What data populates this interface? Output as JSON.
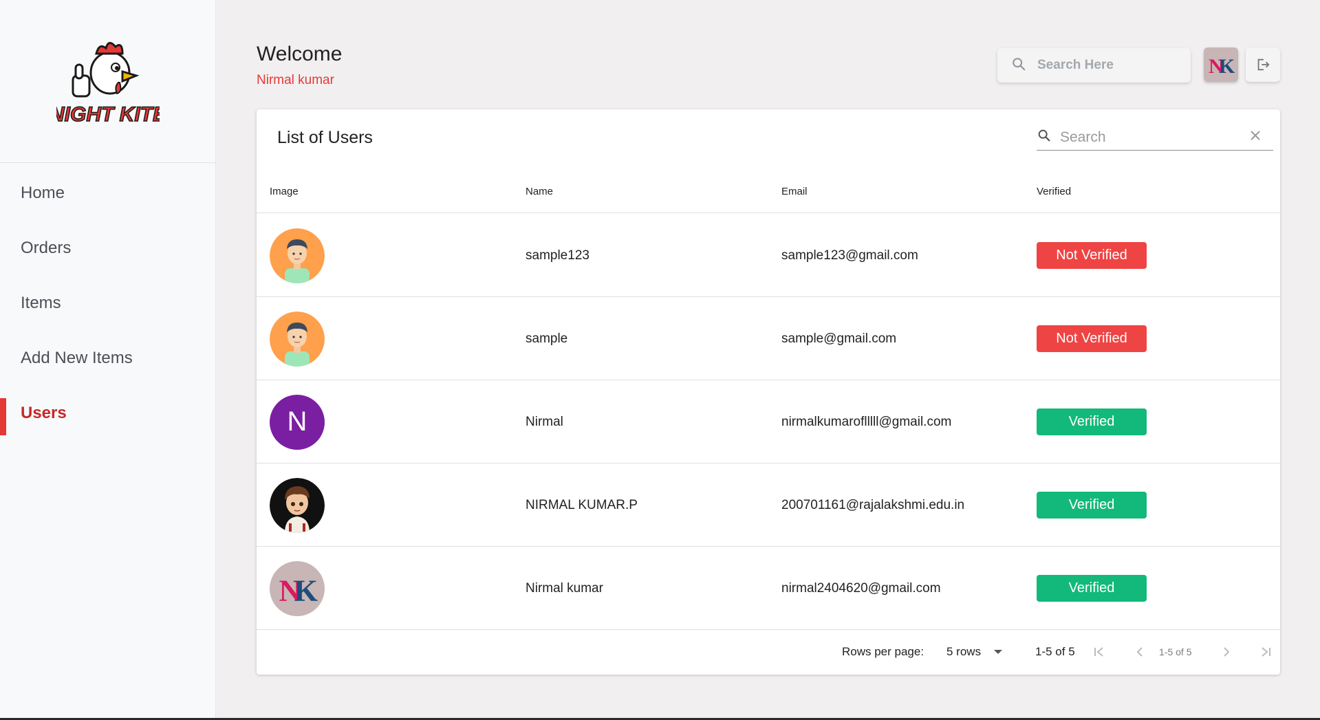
{
  "brand": {
    "logo_text": "NIGHT KITE",
    "accent": "#e53935"
  },
  "sidebar": {
    "items": [
      {
        "label": "Home",
        "active": false
      },
      {
        "label": "Orders",
        "active": false
      },
      {
        "label": "Items",
        "active": false
      },
      {
        "label": "Add New Items",
        "active": false
      },
      {
        "label": "Users",
        "active": true
      }
    ]
  },
  "header": {
    "title": "Welcome",
    "username": "Nirmal kumar",
    "search_placeholder": "Search Here",
    "avatar_initials": "NK"
  },
  "users_table": {
    "title": "List of Users",
    "search_placeholder": "Search",
    "columns": [
      "Image",
      "Name",
      "Email",
      "Verified"
    ],
    "rows": [
      {
        "avatar": "cartoon-man-avatar",
        "name": "sample123",
        "email": "sample123@gmail.com",
        "status": "Not Verified"
      },
      {
        "avatar": "cartoon-man-avatar",
        "name": "sample",
        "email": "sample@gmail.com",
        "status": "Not Verified"
      },
      {
        "avatar": "letter-avatar",
        "avatar_letter": "N",
        "name": "Nirmal",
        "email": "nirmalkumaroflllll@gmail.com",
        "status": "Verified"
      },
      {
        "avatar": "cartoon-boy-avatar",
        "name": "NIRMAL KUMAR.P",
        "email": "200701161@rajalakshmi.edu.in",
        "status": "Verified"
      },
      {
        "avatar": "nk-logo-avatar",
        "avatar_initials": "NK",
        "name": "Nirmal kumar",
        "email": "nirmal2404620@gmail.com",
        "status": "Verified"
      }
    ],
    "status_colors": {
      "Verified": "#13b97a",
      "Not Verified": "#ef4444"
    },
    "pagination": {
      "rows_per_page_label": "Rows per page:",
      "rows_per_page_value": "5 rows",
      "range": "1-5 of 5",
      "range_small": "1-5 of 5"
    }
  }
}
